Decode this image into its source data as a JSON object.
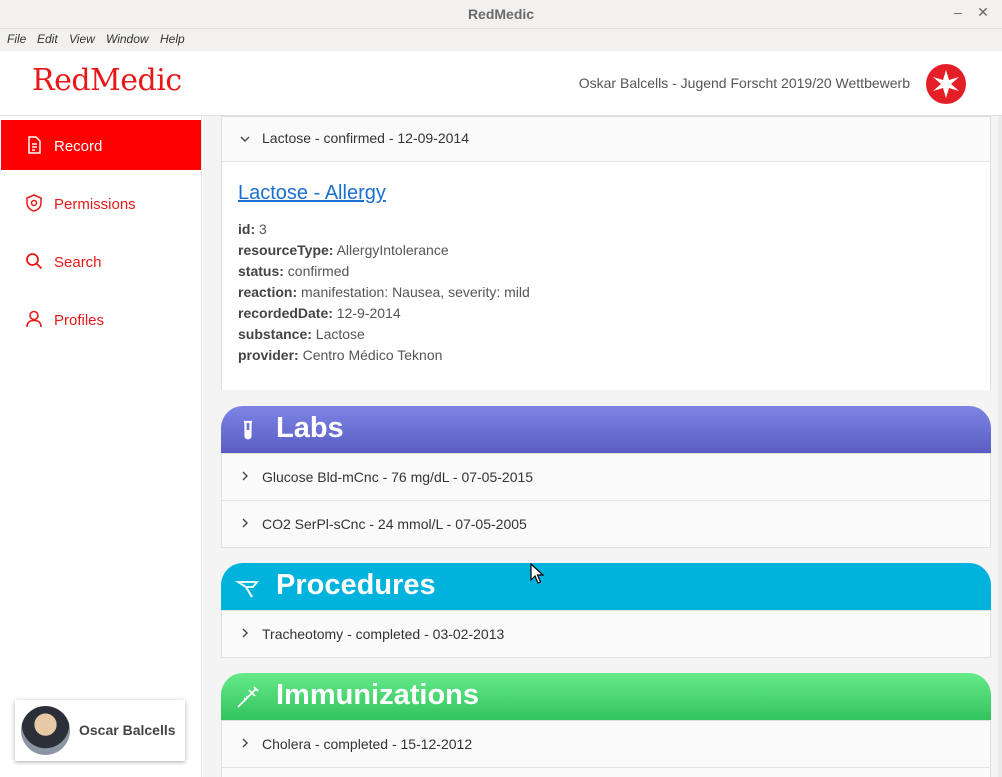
{
  "window": {
    "title": "RedMedic",
    "minimize": "–",
    "close": "✕"
  },
  "menu": [
    "File",
    "Edit",
    "View",
    "Window",
    "Help"
  ],
  "header": {
    "brand": "RedMedic",
    "subtitle": "Oskar Balcells - Jugend Forscht 2019/20 Wettbewerb"
  },
  "sidebar": {
    "items": [
      {
        "label": "Record",
        "icon": "document-icon",
        "active": true
      },
      {
        "label": "Permissions",
        "icon": "shield-icon",
        "active": false
      },
      {
        "label": "Search",
        "icon": "search-icon",
        "active": false
      },
      {
        "label": "Profiles",
        "icon": "user-icon",
        "active": false
      }
    ],
    "user": {
      "name": "Oscar Balcells"
    }
  },
  "allergy": {
    "summary": "Lactose - confirmed - 12-09-2014",
    "title": "Lactose - Allergy",
    "fields": [
      {
        "key": "id:",
        "value": " 3"
      },
      {
        "key": "resourceType:",
        "value": " AllergyIntolerance"
      },
      {
        "key": "status:",
        "value": " confirmed"
      },
      {
        "key": "reaction:",
        "value": " manifestation: Nausea, severity: mild"
      },
      {
        "key": "recordedDate:",
        "value": " 12-9-2014"
      },
      {
        "key": "substance:",
        "value": " Lactose"
      },
      {
        "key": "provider:",
        "value": " Centro Médico Teknon"
      }
    ]
  },
  "labs": {
    "title": "Labs",
    "items": [
      "Glucose Bld-mCnc - 76 mg/dL - 07-05-2015",
      "CO2 SerPl-sCnc - 24 mmol/L - 07-05-2005"
    ]
  },
  "procedures": {
    "title": "Procedures",
    "items": [
      "Tracheotomy - completed - 03-02-2013"
    ]
  },
  "immunizations": {
    "title": "Immunizations",
    "items": [
      "Cholera - completed - 15-12-2012"
    ]
  },
  "colors": {
    "accent": "#ff0000",
    "labs": "#5a5dc4",
    "procedures": "#00b3dd",
    "immunizations": "#33c35f"
  }
}
